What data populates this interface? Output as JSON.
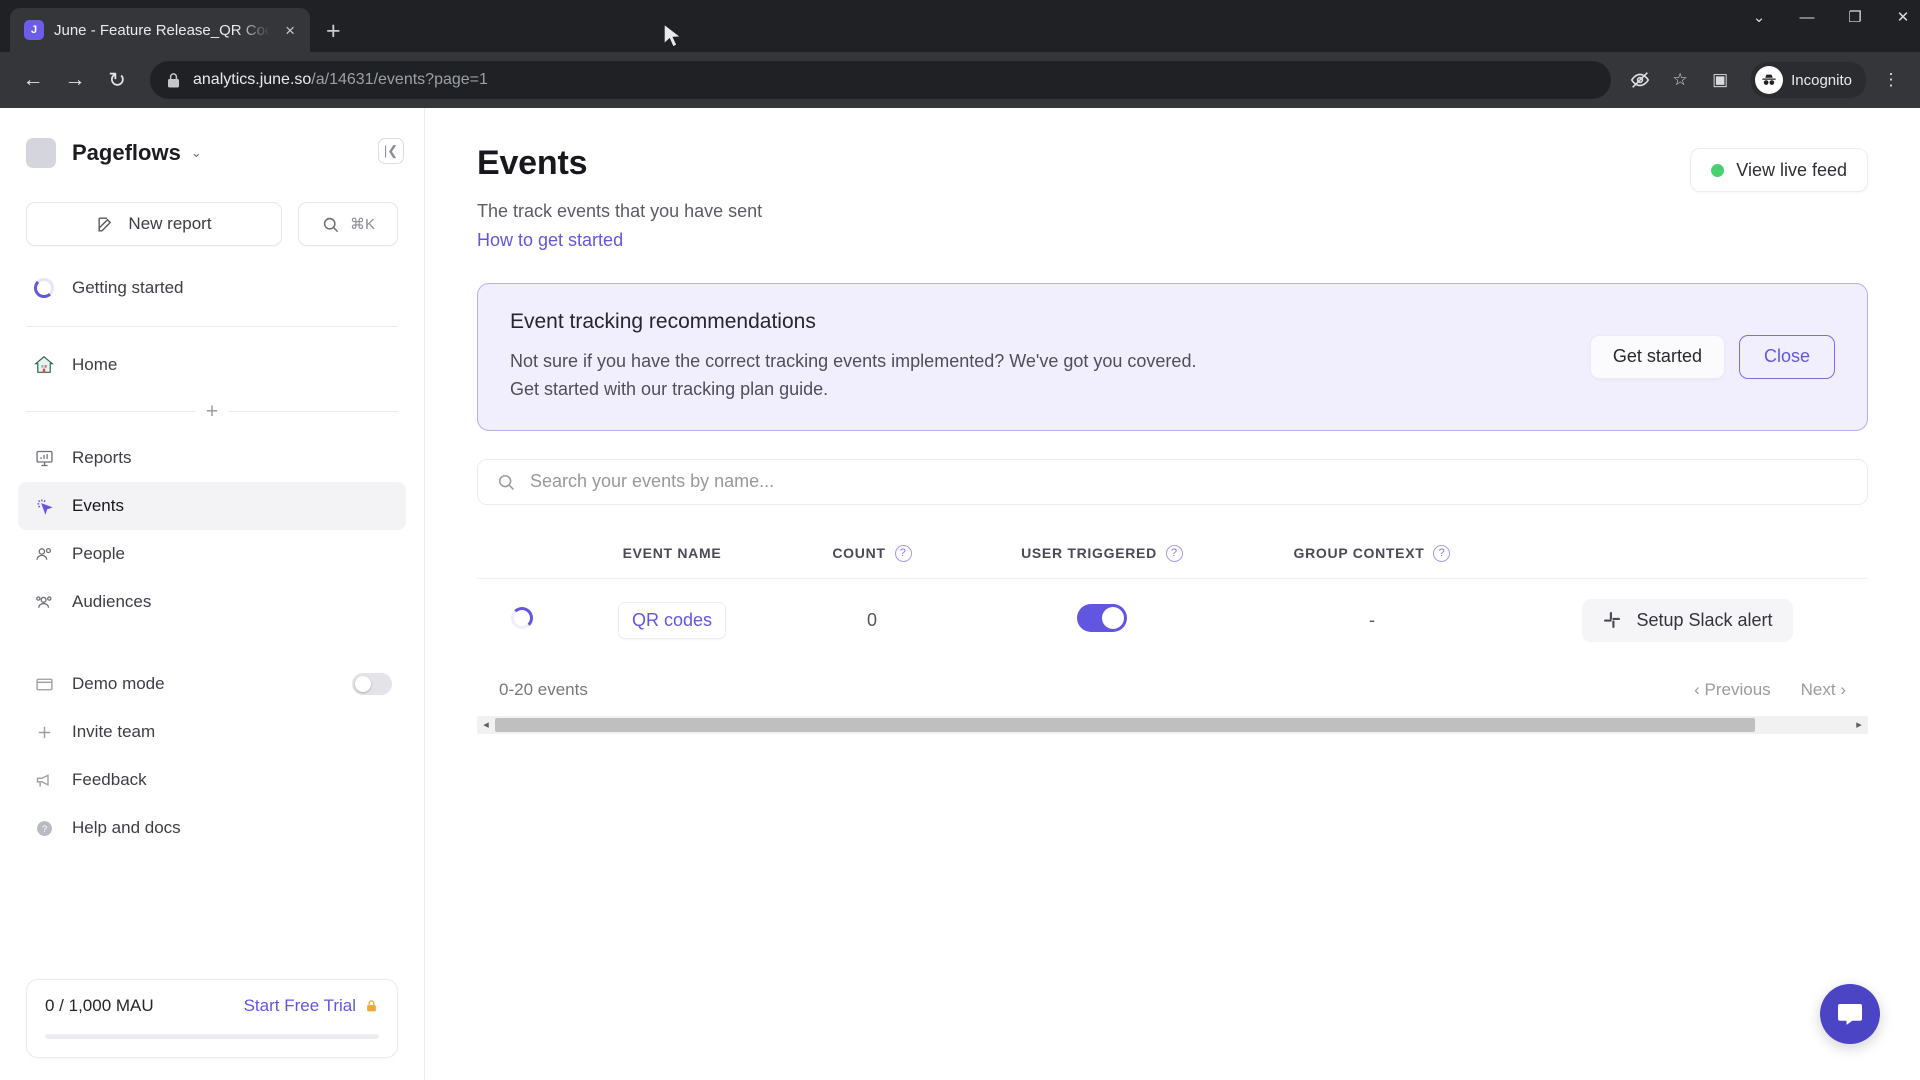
{
  "browser": {
    "tab": {
      "title": "June - Feature Release_QR Code",
      "favicon": "june-logo-icon",
      "close_icon": "×"
    },
    "new_tab_icon": "+",
    "window_controls": {
      "expand": "⌄",
      "minimize": "—",
      "maximize": "❐",
      "close": "✕"
    },
    "nav": {
      "back": "←",
      "forward": "→",
      "reload": "↻"
    },
    "url": {
      "lock_icon": "🔒",
      "domain": "analytics.june.so",
      "path": "/a/14631/events?page=1"
    },
    "toolbar": {
      "third_party_cookies_icon": "eye-slash-icon",
      "bookmark_icon": "☆",
      "side_panel_icon": "▣",
      "incognito_label": "Incognito",
      "menu_icon": "⋮"
    }
  },
  "sidebar": {
    "workspace": {
      "name": "Pageflows",
      "caret": "⌄"
    },
    "collapse_icon": "|❮",
    "new_report": {
      "label": "New report",
      "icon": "pencil-square-icon"
    },
    "search": {
      "icon": "search-icon",
      "shortcut": "⌘K"
    },
    "getting_started": {
      "label": "Getting started",
      "icon": "progress-ring-icon"
    },
    "items": [
      {
        "label": "Home",
        "icon": "home-icon"
      },
      {
        "label": "Reports",
        "icon": "reports-chart-icon"
      },
      {
        "label": "Events",
        "icon": "events-cursor-icon",
        "active": true
      },
      {
        "label": "People",
        "icon": "people-icon"
      },
      {
        "label": "Audiences",
        "icon": "audiences-icon"
      }
    ],
    "add_icon": "+",
    "footer_items": [
      {
        "label": "Demo mode",
        "icon": "window-icon",
        "toggle": "off"
      },
      {
        "label": "Invite team",
        "icon": "plus-icon"
      },
      {
        "label": "Feedback",
        "icon": "megaphone-icon"
      },
      {
        "label": "Help and docs",
        "icon": "question-circle-icon"
      }
    ],
    "mau": {
      "count": "0 / 1,000 MAU",
      "trial_label": "Start Free Trial",
      "lock_icon": "🔒"
    }
  },
  "main": {
    "title": "Events",
    "subtitle": "The track events that you have sent",
    "link": "How to get started",
    "live_feed": {
      "label": "View live feed",
      "dot_color": "#4ad16f"
    },
    "banner": {
      "title": "Event tracking recommendations",
      "text": "Not sure if you have the correct tracking events implemented? We've got you covered. Get started with our tracking plan guide.",
      "primary": "Get started",
      "secondary": "Close"
    },
    "search": {
      "placeholder": "Search your events by name...",
      "value": "",
      "icon": "search-icon"
    },
    "table": {
      "columns": [
        {
          "label": "EVENT NAME",
          "help": false
        },
        {
          "label": "COUNT",
          "help": true
        },
        {
          "label": "USER TRIGGERED",
          "help": true
        },
        {
          "label": "GROUP CONTEXT",
          "help": true
        }
      ],
      "rows": [
        {
          "status_icon": "loading-spinner-icon",
          "event_name": "QR codes",
          "count": "0",
          "user_triggered": "on",
          "group_context": "-",
          "action": {
            "label": "Setup Slack alert",
            "icon": "slack-icon"
          }
        }
      ]
    },
    "pagination": {
      "summary": "0-20 events",
      "previous": "‹ Previous",
      "next": "Next ›"
    },
    "scrollbar": {
      "left_arrow": "◂",
      "right_arrow": "▸"
    },
    "intercom_icon": "chat-bubble-icon"
  },
  "colors": {
    "accent": "#6256e0",
    "banner_bg": "#f1eefd",
    "banner_border": "#b9afee",
    "live_dot": "#4ad16f"
  }
}
